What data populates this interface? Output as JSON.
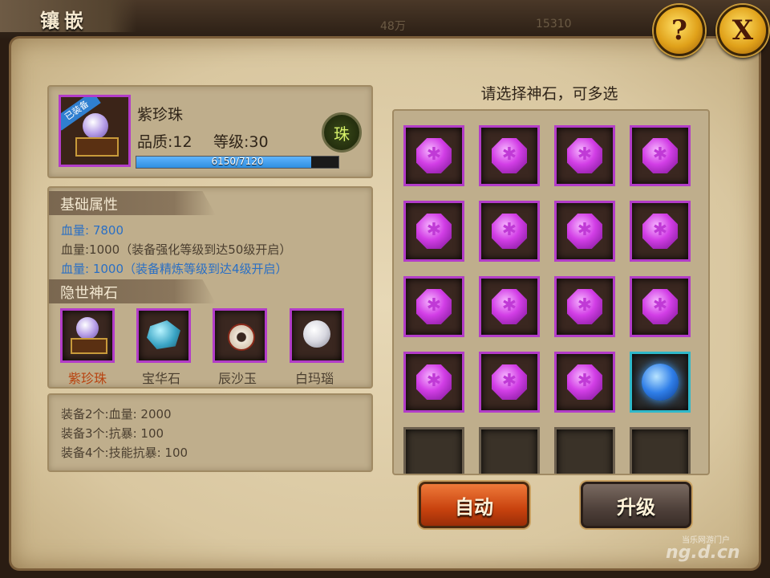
{
  "header": {
    "title": "镶嵌",
    "resource_1": "48万",
    "resource_2": "15310",
    "help_label": "?",
    "close_label": "X"
  },
  "equipment": {
    "name": "紫珍珠",
    "badge": "已装备",
    "quality_label": "品质:12",
    "level_label": "等级:30",
    "exp_text": "6150/7120",
    "exp_fraction": 0.864,
    "type_icon": "珠"
  },
  "attributes": {
    "header": "基础属性",
    "lines": [
      "血量: 7800",
      "血量:1000（装备强化等级到达50级开启）",
      "血量: 1000（装备精炼等级到达4级开启）"
    ]
  },
  "hidden_stones": {
    "header": "隐世神石",
    "items": [
      "紫珍珠",
      "宝华石",
      "辰沙玉",
      "白玛瑙"
    ]
  },
  "set_bonus": {
    "lines": [
      "装备2个:血量: 2000",
      "装备3个:抗暴: 100",
      "装备4个:技能抗暴: 100"
    ]
  },
  "selection": {
    "prompt": "请选择神石，可多选",
    "slots": [
      "purple",
      "purple",
      "purple",
      "purple",
      "purple",
      "purple",
      "purple",
      "purple",
      "purple",
      "purple",
      "purple",
      "purple",
      "purple",
      "purple",
      "purple",
      "blue",
      "empty",
      "empty",
      "empty",
      "empty"
    ]
  },
  "buttons": {
    "auto": "自动",
    "upgrade": "升级"
  },
  "watermark": {
    "line1": "当乐网游门户",
    "line2": "ng.d.cn"
  },
  "colors": {
    "slot_border_purple": "#b23cc8",
    "slot_border_blue": "#2fb8c9",
    "exp_bar": "#2f8fe0",
    "auto_button": "#d7531c",
    "upgrade_button": "#5a4c44"
  }
}
